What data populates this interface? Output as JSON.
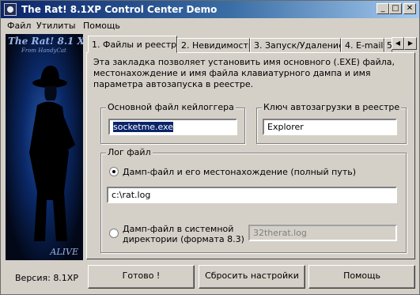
{
  "window": {
    "title": "The Rat! 8.1XP Control Center Demo",
    "minimize": "_",
    "maximize": "□",
    "close": "✕"
  },
  "menu": {
    "items": [
      "Файл",
      "Утилиты",
      "Помощь"
    ]
  },
  "sidebar": {
    "logo": "The Rat! 8.1 XP",
    "subtitle": "From HandyCat",
    "badge": "ALIVE",
    "version": "Версия: 8.1XP"
  },
  "tabs": [
    {
      "label": "1. Файлы и реестр",
      "active": true
    },
    {
      "label": "2. Невидимость",
      "active": false
    },
    {
      "label": "3. Запуск/Удаление",
      "active": false
    },
    {
      "label": "4. E-mail",
      "active": false
    },
    {
      "label": "5",
      "active": false
    }
  ],
  "tab_scroll": {
    "left": "◀",
    "right": "▶"
  },
  "intro_text": "Эта закладка позволяет установить имя основного (.EXE) файла, местонахождение и имя файла клавиатурного дампа и имя параметра автозапуска в реестре.",
  "keylogger_group": {
    "label": "Основной файл кейлоггера",
    "value": "socketme.exe"
  },
  "registry_group": {
    "label": "Ключ автозагрузки в реестре",
    "value": "Explorer"
  },
  "log_group": {
    "label": "Лог файл",
    "option1": {
      "label": "Дамп-файл и его местонахождение (полный путь)",
      "checked": true,
      "path": "c:\\rat.log"
    },
    "option2": {
      "line1": "Дамп-файл в системной",
      "line2": "директории (формата 8.3)",
      "checked": false,
      "value": "32therat.log"
    }
  },
  "buttons": {
    "done": "Готово !",
    "reset": "Сбросить настройки",
    "help": "Помощь"
  }
}
